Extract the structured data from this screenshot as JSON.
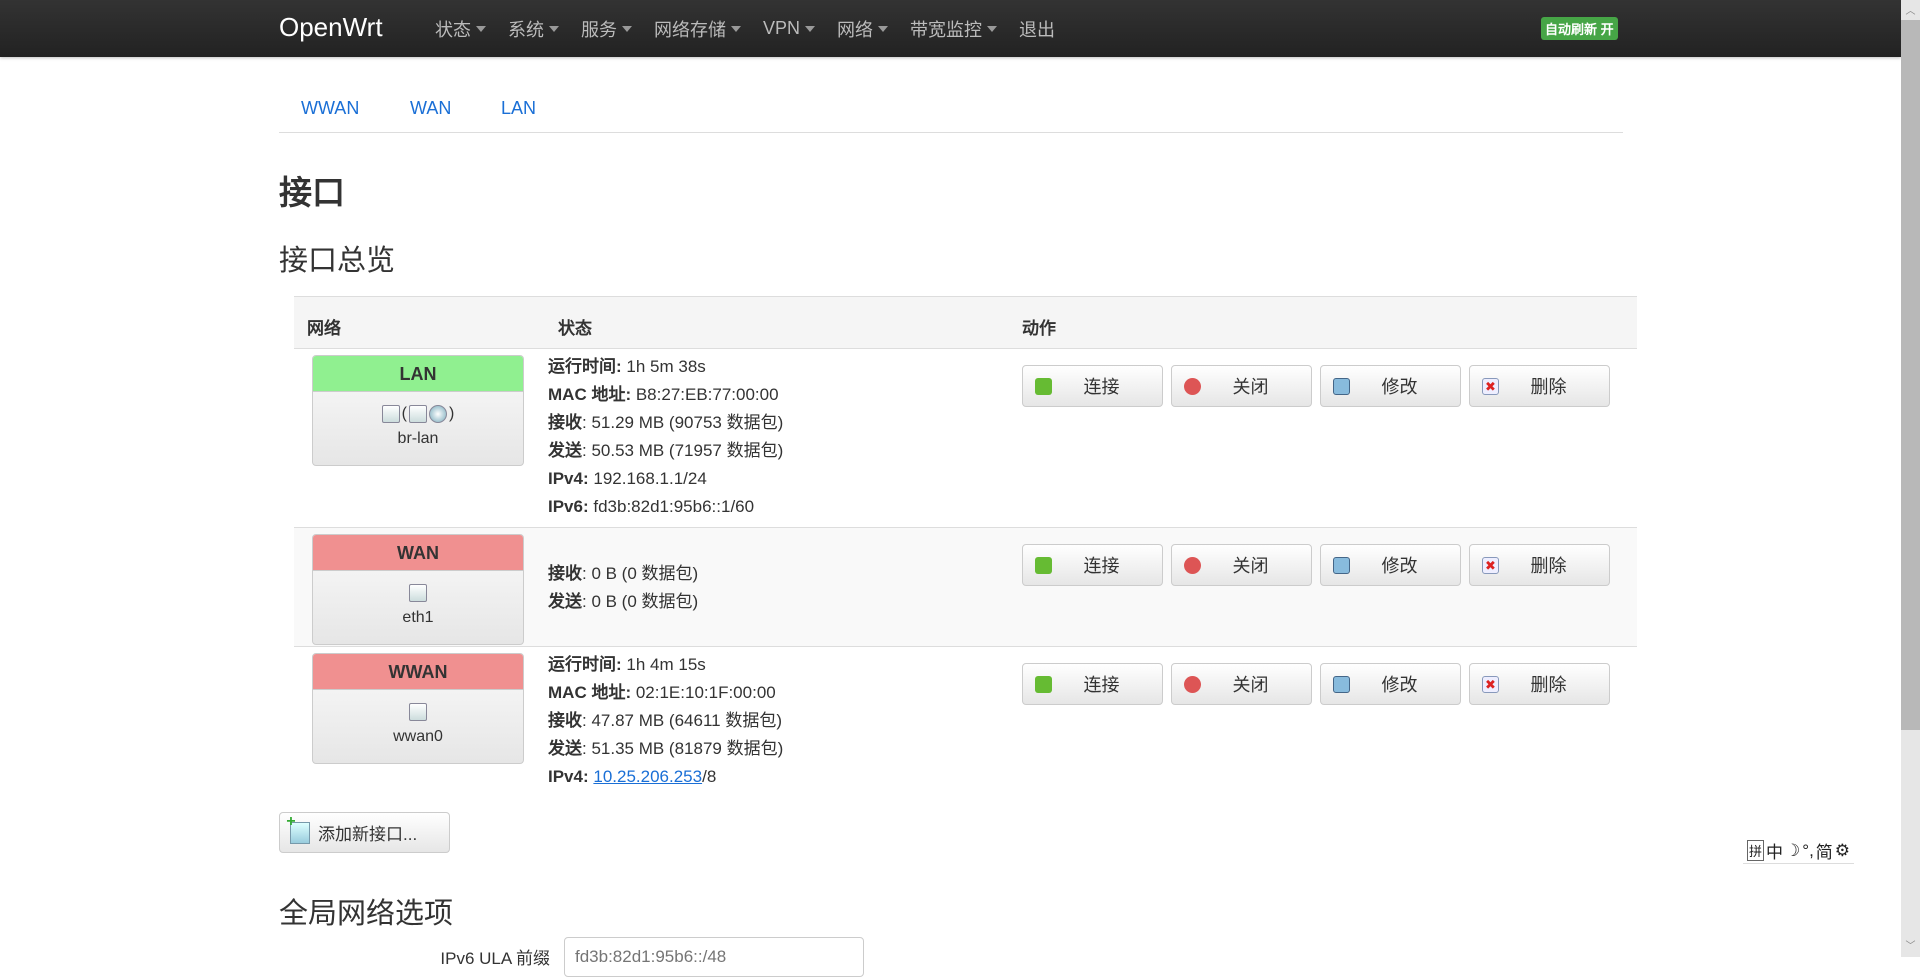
{
  "nav": {
    "brand": "OpenWrt",
    "menu": [
      "状态",
      "系统",
      "服务",
      "网络存储",
      "VPN",
      "网络",
      "带宽监控"
    ],
    "logout": "退出",
    "autorefresh": "自动刷新 开"
  },
  "tabs": [
    "WWAN",
    "WAN",
    "LAN"
  ],
  "page_title": "接口",
  "overview_title": "接口总览",
  "table": {
    "headers": [
      "网络",
      "状态",
      "动作"
    ],
    "rows": [
      {
        "name": "LAN",
        "state": "up",
        "device": "br-lan",
        "lines": [
          [
            "运行时间:",
            "1h 5m 38s"
          ],
          [
            "MAC 地址:",
            "B8:27:EB:77:00:00"
          ],
          [
            "接收",
            ": 51.29 MB (90753 数据包)"
          ],
          [
            "发送",
            ": 50.53 MB (71957 数据包)"
          ],
          [
            "IPv4:",
            "192.168.1.1/24"
          ],
          [
            "IPv6:",
            "fd3b:82d1:95b6::1/60"
          ]
        ]
      },
      {
        "name": "WAN",
        "state": "down",
        "device": "eth1",
        "lines": [
          [
            "接收",
            ": 0 B (0 数据包)"
          ],
          [
            "发送",
            ": 0 B (0 数据包)"
          ]
        ]
      },
      {
        "name": "WWAN",
        "state": "down",
        "device": "wwan0",
        "lines": [
          [
            "运行时间:",
            "1h 4m 15s"
          ],
          [
            "MAC 地址:",
            "02:1E:10:1F:00:00"
          ],
          [
            "接收",
            ": 47.87 MB (64611 数据包)"
          ],
          [
            "发送",
            ": 51.35 MB (81879 数据包)"
          ]
        ],
        "ipv4_label": "IPv4:",
        "ipv4_link": "10.25.206.253",
        "ipv4_suffix": "/8"
      }
    ],
    "buttons": [
      "连接",
      "关闭",
      "修改",
      "删除"
    ]
  },
  "add_interface": "添加新接口...",
  "global_title": "全局网络选项",
  "ula": {
    "label": "IPv6 ULA 前缀",
    "placeholder": "fd3b:82d1:95b6::/48"
  },
  "ime": {
    "items": [
      "拼",
      "中",
      "☽",
      "°,",
      "简",
      "⚙"
    ]
  }
}
